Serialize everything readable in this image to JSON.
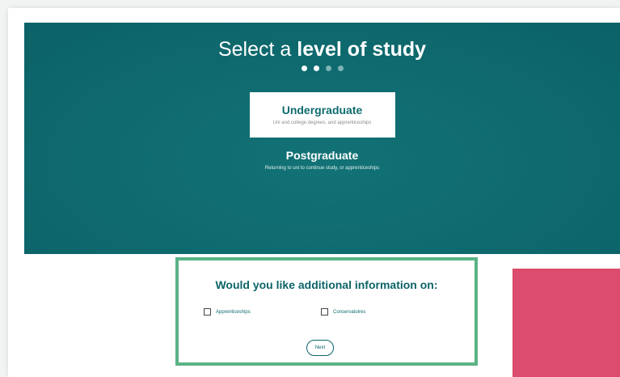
{
  "hero": {
    "title_prefix": "Select a ",
    "title_bold": "level of study",
    "steps": {
      "total": 4,
      "active": 2
    }
  },
  "levels": [
    {
      "title": "Undergraduate",
      "subtitle": "Uni and college degrees, and apprenticeships",
      "selected": true
    },
    {
      "title": "Postgraduate",
      "subtitle": "Returning to uni to continue study, or apprenticeships",
      "selected": false
    }
  ],
  "info": {
    "title": "Would you like additional information on:",
    "options": [
      {
        "label": "Apprenticeships",
        "checked": false
      },
      {
        "label": "Conservatoires",
        "checked": false
      }
    ],
    "next_label": "Next"
  },
  "colors": {
    "hero_bg": "#0f6b6f",
    "accent_border": "#5ab386",
    "side_panel": "#dc4c6c"
  }
}
